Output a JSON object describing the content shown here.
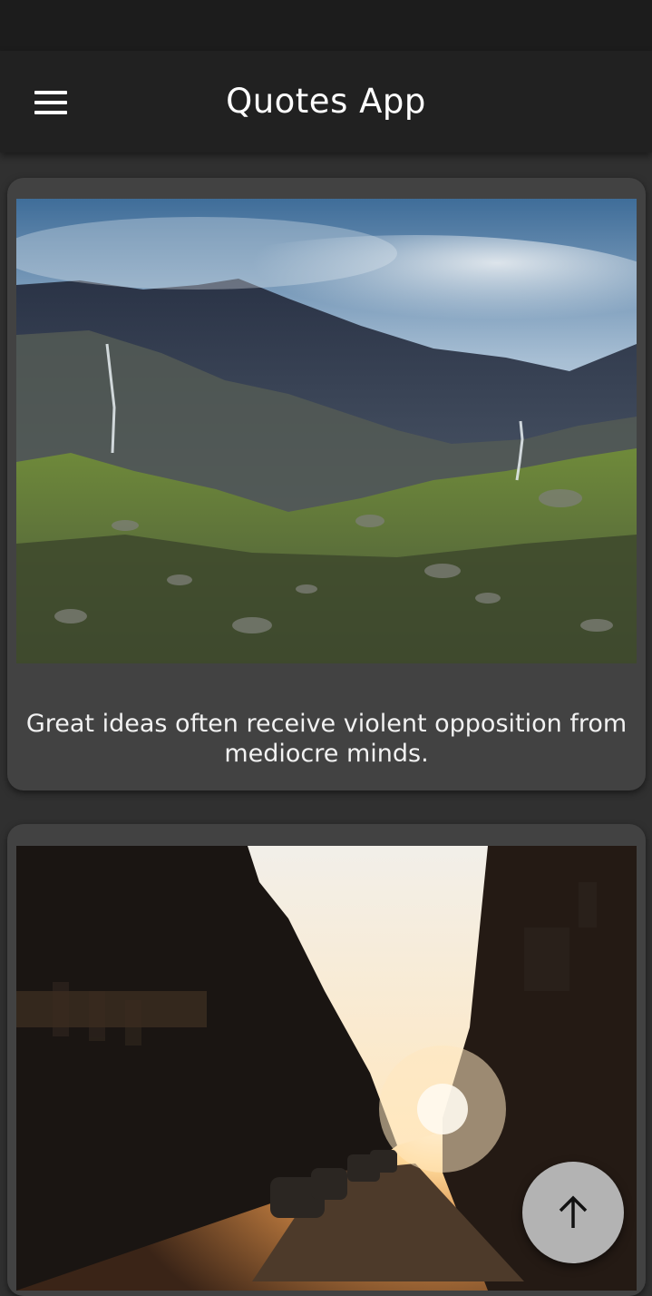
{
  "app_bar": {
    "title": "Quotes App",
    "menu_icon": "hamburger-menu-icon"
  },
  "feed": [
    {
      "image_subject": "misty mountain valley with waterfalls and rocky green slopes",
      "quote": "Great ideas often receive violent opposition from mediocre minds."
    },
    {
      "image_subject": "city street with buildings and parked cars at sunset"
    }
  ],
  "fab": {
    "icon": "arrow-up-icon"
  },
  "colors": {
    "background": "#303030",
    "app_bar": "#212121",
    "status_bar": "#1c1c1c",
    "card": "#424242",
    "fab": "#b3b3b3",
    "text": "#ffffff"
  }
}
